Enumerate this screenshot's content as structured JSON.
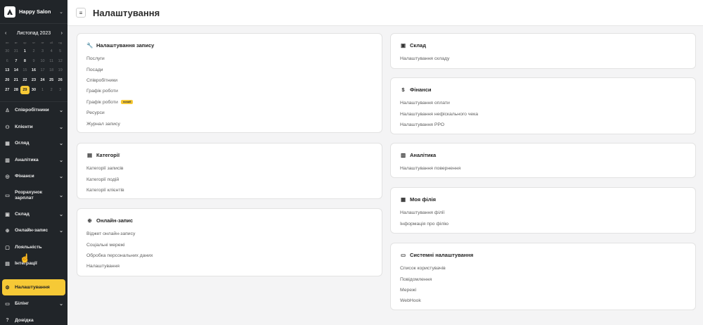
{
  "sidebar": {
    "brand": {
      "name": "Happy Salon"
    },
    "calendar": {
      "month_label": "Листопад 2023",
      "weekdays": [
        "пн",
        "вт",
        "ср",
        "чт",
        "пт",
        "сб",
        "нд"
      ],
      "days": [
        {
          "d": "30",
          "muted": true
        },
        {
          "d": "31",
          "muted": true
        },
        {
          "d": "1",
          "muted": false
        },
        {
          "d": "2",
          "muted": true
        },
        {
          "d": "3",
          "muted": true
        },
        {
          "d": "4",
          "muted": true
        },
        {
          "d": "5",
          "muted": true
        },
        {
          "d": "6",
          "muted": true
        },
        {
          "d": "7",
          "muted": false
        },
        {
          "d": "8",
          "muted": false
        },
        {
          "d": "9",
          "muted": true
        },
        {
          "d": "10",
          "muted": true
        },
        {
          "d": "11",
          "muted": true
        },
        {
          "d": "12",
          "muted": true
        },
        {
          "d": "13",
          "muted": false
        },
        {
          "d": "14",
          "muted": false
        },
        {
          "d": "15",
          "muted": true
        },
        {
          "d": "16",
          "muted": false
        },
        {
          "d": "17",
          "muted": true
        },
        {
          "d": "18",
          "muted": true
        },
        {
          "d": "19",
          "muted": true
        },
        {
          "d": "20",
          "muted": false
        },
        {
          "d": "21",
          "muted": false
        },
        {
          "d": "22",
          "muted": false
        },
        {
          "d": "23",
          "muted": false
        },
        {
          "d": "24",
          "muted": false
        },
        {
          "d": "25",
          "muted": false
        },
        {
          "d": "26",
          "muted": false
        },
        {
          "d": "27",
          "muted": false
        },
        {
          "d": "28",
          "muted": false
        },
        {
          "d": "29",
          "muted": false,
          "today": true
        },
        {
          "d": "30",
          "muted": false
        },
        {
          "d": "1",
          "muted": true
        },
        {
          "d": "2",
          "muted": true
        },
        {
          "d": "3",
          "muted": true
        }
      ]
    },
    "menu": [
      {
        "label": "Співробітники",
        "icon": "user-icon",
        "chevron": true
      },
      {
        "label": "Клієнти",
        "icon": "users-icon",
        "chevron": true
      },
      {
        "label": "Огляд",
        "icon": "grid-icon",
        "chevron": true
      },
      {
        "label": "Аналітика",
        "icon": "chart-icon",
        "chevron": true
      },
      {
        "label": "Фінанси",
        "icon": "coins-icon",
        "chevron": true
      },
      {
        "label": "Розрахунок зарплат",
        "icon": "wallet-icon",
        "chevron": true,
        "tall": true
      },
      {
        "label": "Склад",
        "icon": "box-icon",
        "chevron": true
      },
      {
        "label": "Онлайн-запис",
        "icon": "globe-icon",
        "chevron": true
      },
      {
        "label": "Лояльність",
        "icon": "gift-icon",
        "chevron": false
      },
      {
        "label": "Інтеграції",
        "icon": "plug-icon",
        "chevron": false
      },
      {
        "label": "Налаштування",
        "icon": "gear-icon",
        "chevron": false,
        "active": true
      },
      {
        "label": "Білінг",
        "icon": "card-icon",
        "chevron": true
      },
      {
        "label": "Довідка",
        "icon": "help-icon",
        "chevron": false
      }
    ]
  },
  "header": {
    "title": "Налаштування",
    "menu_icon": "hamburger-icon"
  },
  "cards_left": [
    {
      "title": "Налаштування запису",
      "icon": "wrench-icon",
      "links": [
        {
          "label": "Послуги"
        },
        {
          "label": "Посади"
        },
        {
          "label": "Співробітники"
        },
        {
          "label": "Графік роботи"
        },
        {
          "label": "Графік роботи",
          "badge": "новий"
        },
        {
          "label": "Ресурси"
        },
        {
          "label": "Журнал запису"
        }
      ]
    },
    {
      "title": "Категорії",
      "icon": "folder-icon",
      "links": [
        {
          "label": "Категорії записів"
        },
        {
          "label": "Категорії подій"
        },
        {
          "label": "Категорії клієнтів"
        }
      ]
    },
    {
      "title": "Онлайн-запис",
      "icon": "globe-icon",
      "links": [
        {
          "label": "Віджет онлайн-запису"
        },
        {
          "label": "Соціальні мережі"
        },
        {
          "label": "Обробка персональних даних"
        },
        {
          "label": "Налаштування"
        }
      ]
    }
  ],
  "cards_right": [
    {
      "title": "Склад",
      "icon": "box-icon",
      "links": [
        {
          "label": "Налаштування складу"
        }
      ]
    },
    {
      "title": "Фінанси",
      "icon": "dollar-icon",
      "links": [
        {
          "label": "Налаштування оплати"
        },
        {
          "label": "Налаштування нефіскального чека"
        },
        {
          "label": "Налаштування РРО"
        }
      ]
    },
    {
      "title": "Аналітика",
      "icon": "chart-icon",
      "links": [
        {
          "label": "Налаштування повернення"
        }
      ]
    },
    {
      "title": "Моя філія",
      "icon": "branch-icon",
      "links": [
        {
          "label": "Налаштування філії"
        },
        {
          "label": "Інформація про філію"
        }
      ]
    },
    {
      "title": "Системні налаштування",
      "icon": "monitor-icon",
      "links": [
        {
          "label": "Список користувачів"
        },
        {
          "label": "Повідомлення"
        },
        {
          "label": "Мережі"
        },
        {
          "label": "WebHook"
        }
      ]
    }
  ]
}
